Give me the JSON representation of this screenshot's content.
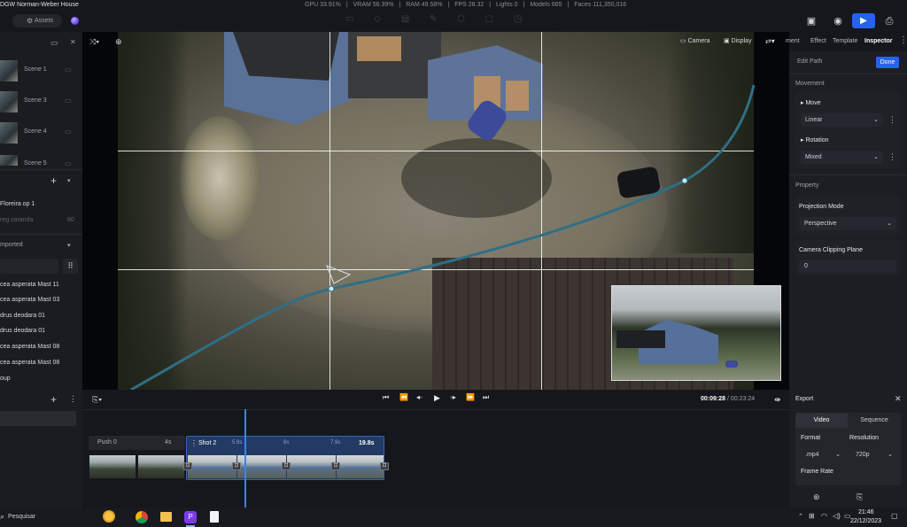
{
  "topbar": {
    "project_title": "DGW Norman-Weber House",
    "assets_label": "Assets",
    "stats": {
      "gpu": "GPU 33.91%",
      "vram": "VRAM 56.39%",
      "ram": "RAM 49.58%",
      "fps": "FPS 28.32",
      "lights": "Lights 0",
      "models": "Models 665",
      "faces": "Faces 111,350,016"
    }
  },
  "scenes": [
    {
      "label": "Scene 1"
    },
    {
      "label": "Scene 3"
    },
    {
      "label": "Scene 4"
    },
    {
      "label": "Scene 5"
    }
  ],
  "layers": {
    "item1": "Floreira op 1",
    "item2": "reg varanda",
    "item2_count": "80"
  },
  "imported": {
    "header": "mported",
    "items": [
      "cea asperata Mast 11",
      "cea asperata Mast 03",
      "drus deodara 01",
      "drus deodara 01",
      "cea asperata Mast 08",
      "cea asperata Mast 08",
      "oup"
    ]
  },
  "viewport": {
    "camera_label": "Camera",
    "display_label": "Display"
  },
  "right_tabs": {
    "tab1": "ment",
    "tab2": "Effect",
    "tab3": "Template",
    "tab4": "Inspector"
  },
  "inspector": {
    "edit_path": "Edit Path",
    "done": "Done",
    "movement_header": "Movement",
    "move_label": "Move",
    "move_value": "Linear",
    "rotation_label": "Rotation",
    "rotation_value": "Mixed",
    "property_header": "Property",
    "projection_label": "Projection Mode",
    "projection_value": "Perspective",
    "clipping_label": "Camera Clipping Plane",
    "clipping_value": "0"
  },
  "timeline": {
    "current_time": "00:09:28",
    "separator": "/",
    "total_time": "00:23:24",
    "shots": [
      {
        "name": "Push 0",
        "duration": "4s"
      },
      {
        "name": "Shot 2",
        "marker1": "5.9s",
        "marker2": "6s",
        "marker3": "7.9s",
        "duration": "19.8s"
      }
    ]
  },
  "export": {
    "title": "Export",
    "tab_video": "Video",
    "tab_sequence": "Sequence",
    "format_label": "Format",
    "format_value": ".mp4",
    "resolution_label": "Resolution",
    "resolution_value": "720p",
    "frame_rate_label": "Frame Rate"
  },
  "taskbar": {
    "search_placeholder": "Pesquisar",
    "time": "21:46",
    "date": "22/12/2023"
  },
  "colors": {
    "accent": "#2563eb",
    "path_line": "#2f6f86",
    "timeline_playhead": "#3b82f6",
    "shot_selected": "#233a63"
  }
}
